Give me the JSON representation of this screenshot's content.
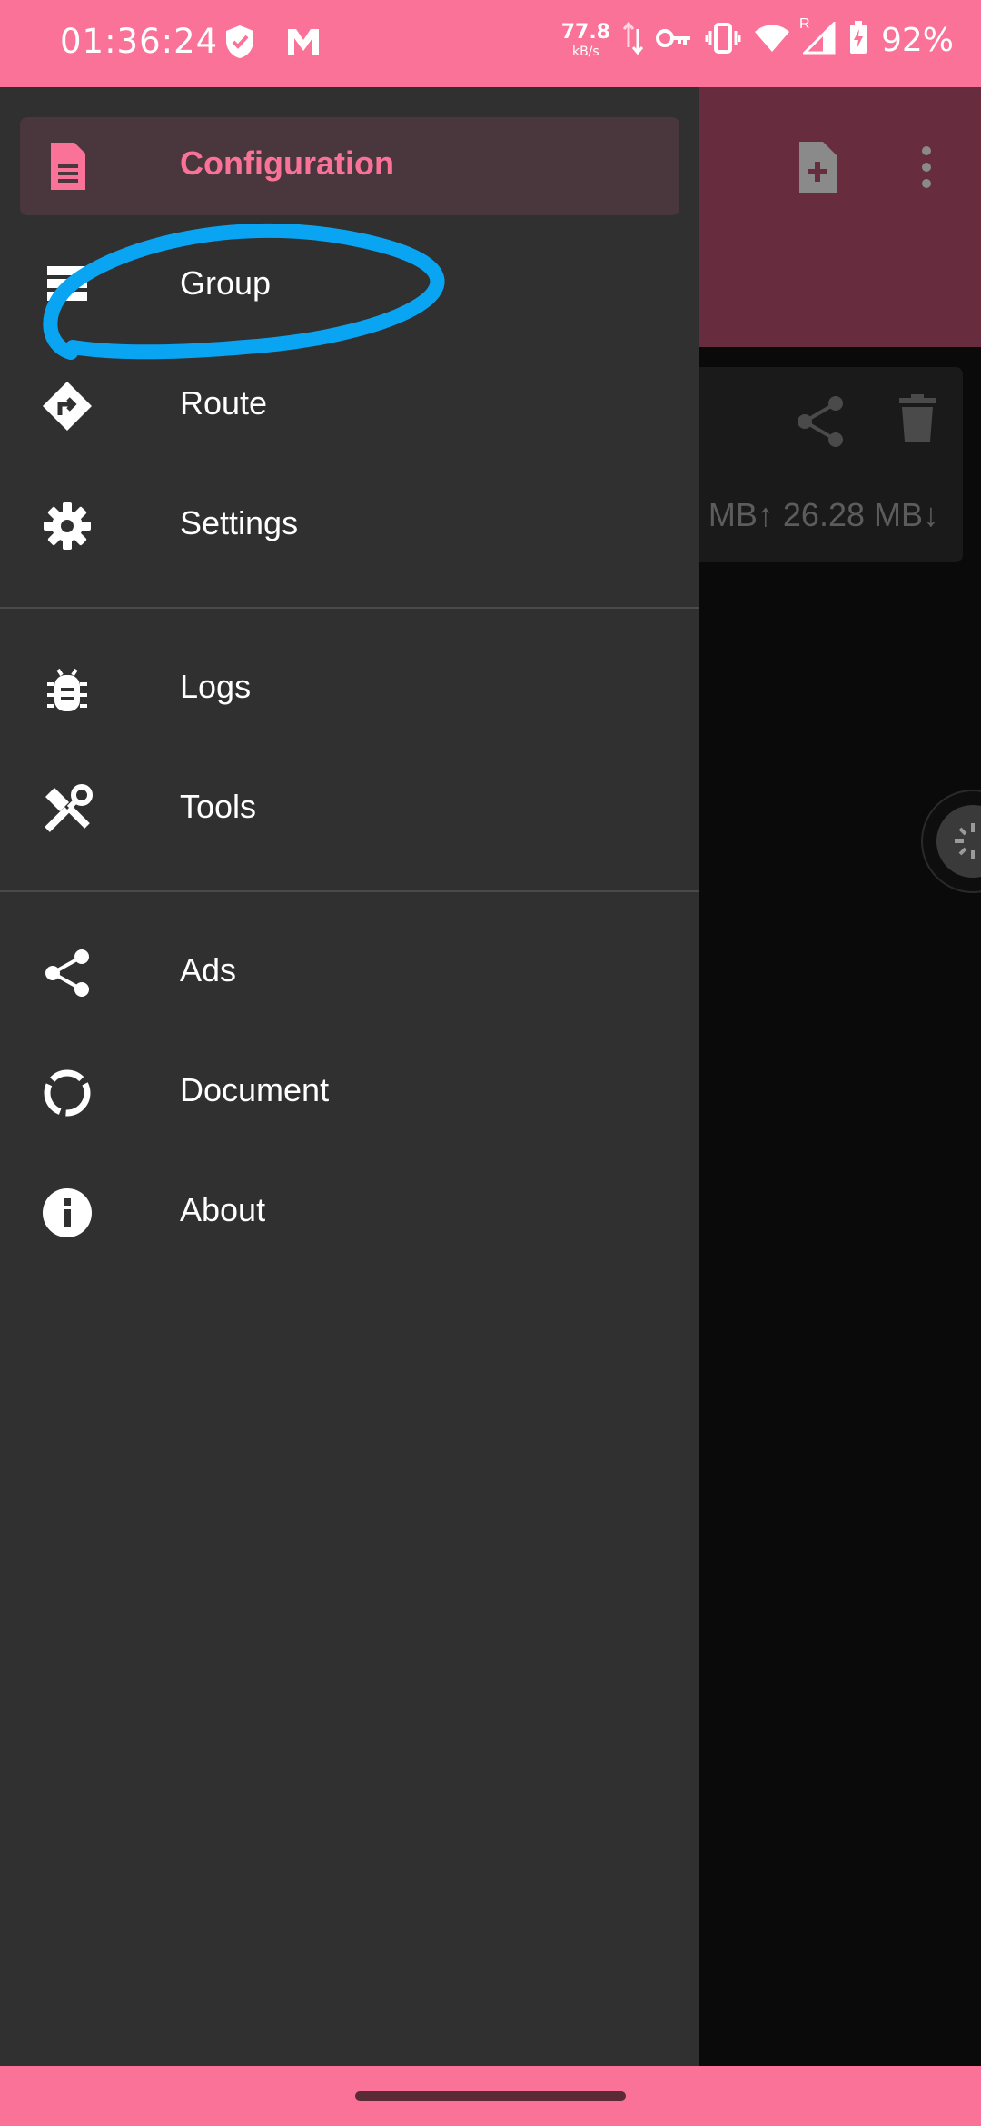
{
  "status_bar": {
    "time": "01:36:24",
    "net_speed_value": "77.8",
    "net_speed_unit": "kB/s",
    "signal_badge": "R",
    "battery": "92%",
    "background_color": "#fb7299"
  },
  "drawer": {
    "accent_color": "#fb7299",
    "items": [
      {
        "label": "Configuration",
        "icon": "document-icon",
        "active": true
      },
      {
        "label": "Group",
        "icon": "list-icon"
      },
      {
        "label": "Route",
        "icon": "route-sign-icon"
      },
      {
        "label": "Settings",
        "icon": "gear-icon"
      },
      {
        "label": "Logs",
        "icon": "bug-icon"
      },
      {
        "label": "Tools",
        "icon": "tools-icon"
      },
      {
        "label": "Ads",
        "icon": "share-icon"
      },
      {
        "label": "Document",
        "icon": "progress-circle-icon"
      },
      {
        "label": "About",
        "icon": "info-icon"
      }
    ]
  },
  "background_app": {
    "toolbar_icons": [
      "add-document-icon",
      "more-vertical-icon"
    ],
    "card": {
      "traffic": "MB↑ 26.28 MB↓",
      "icons": [
        "share-icon",
        "delete-icon"
      ]
    }
  }
}
